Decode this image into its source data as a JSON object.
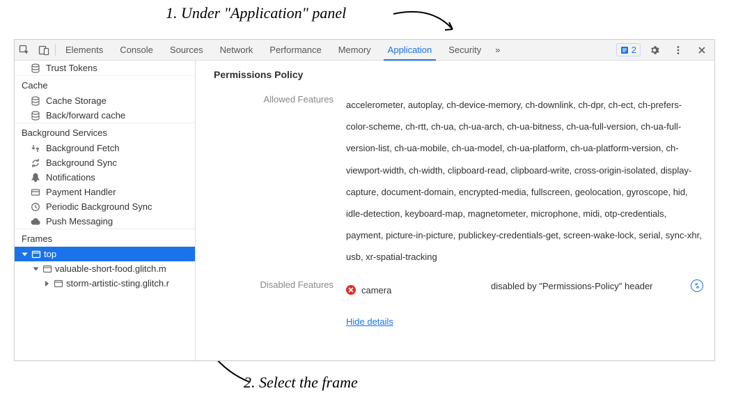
{
  "annotations": {
    "top": "1. Under \"Application\" panel",
    "bottom": "2. Select the frame"
  },
  "toolbar": {
    "tabs": [
      "Elements",
      "Console",
      "Sources",
      "Network",
      "Performance",
      "Memory",
      "Application",
      "Security"
    ],
    "active_tab": "Application",
    "more": "»",
    "issues_count": "2"
  },
  "sidebar": {
    "items0": {
      "trust_tokens": "Trust Tokens"
    },
    "groups": {
      "cache": {
        "title": "Cache",
        "items": [
          "Cache Storage",
          "Back/forward cache"
        ]
      },
      "bg": {
        "title": "Background Services",
        "items": [
          "Background Fetch",
          "Background Sync",
          "Notifications",
          "Payment Handler",
          "Periodic Background Sync",
          "Push Messaging"
        ]
      },
      "frames": {
        "title": "Frames",
        "top": "top",
        "children": [
          "valuable-short-food.glitch.m",
          "storm-artistic-sting.glitch.r"
        ]
      }
    }
  },
  "main": {
    "heading": "Permissions Policy",
    "allowed_label": "Allowed Features",
    "allowed_text": "accelerometer, autoplay, ch-device-memory, ch-downlink, ch-dpr, ch-ect, ch-prefers-color-scheme, ch-rtt, ch-ua, ch-ua-arch, ch-ua-bitness, ch-ua-full-version, ch-ua-full-version-list, ch-ua-mobile, ch-ua-model, ch-ua-platform, ch-ua-platform-version, ch-viewport-width, ch-width, clipboard-read, clipboard-write, cross-origin-isolated, display-capture, document-domain, encrypted-media, fullscreen, geolocation, gyroscope, hid, idle-detection, keyboard-map, magnetometer, microphone, midi, otp-credentials, payment, picture-in-picture, publickey-credentials-get, screen-wake-lock, serial, sync-xhr, usb, xr-spatial-tracking",
    "disabled_label": "Disabled Features",
    "disabled_item": "camera",
    "disabled_reason": "disabled by \"Permissions-Policy\" header",
    "hide_details": "Hide details"
  }
}
